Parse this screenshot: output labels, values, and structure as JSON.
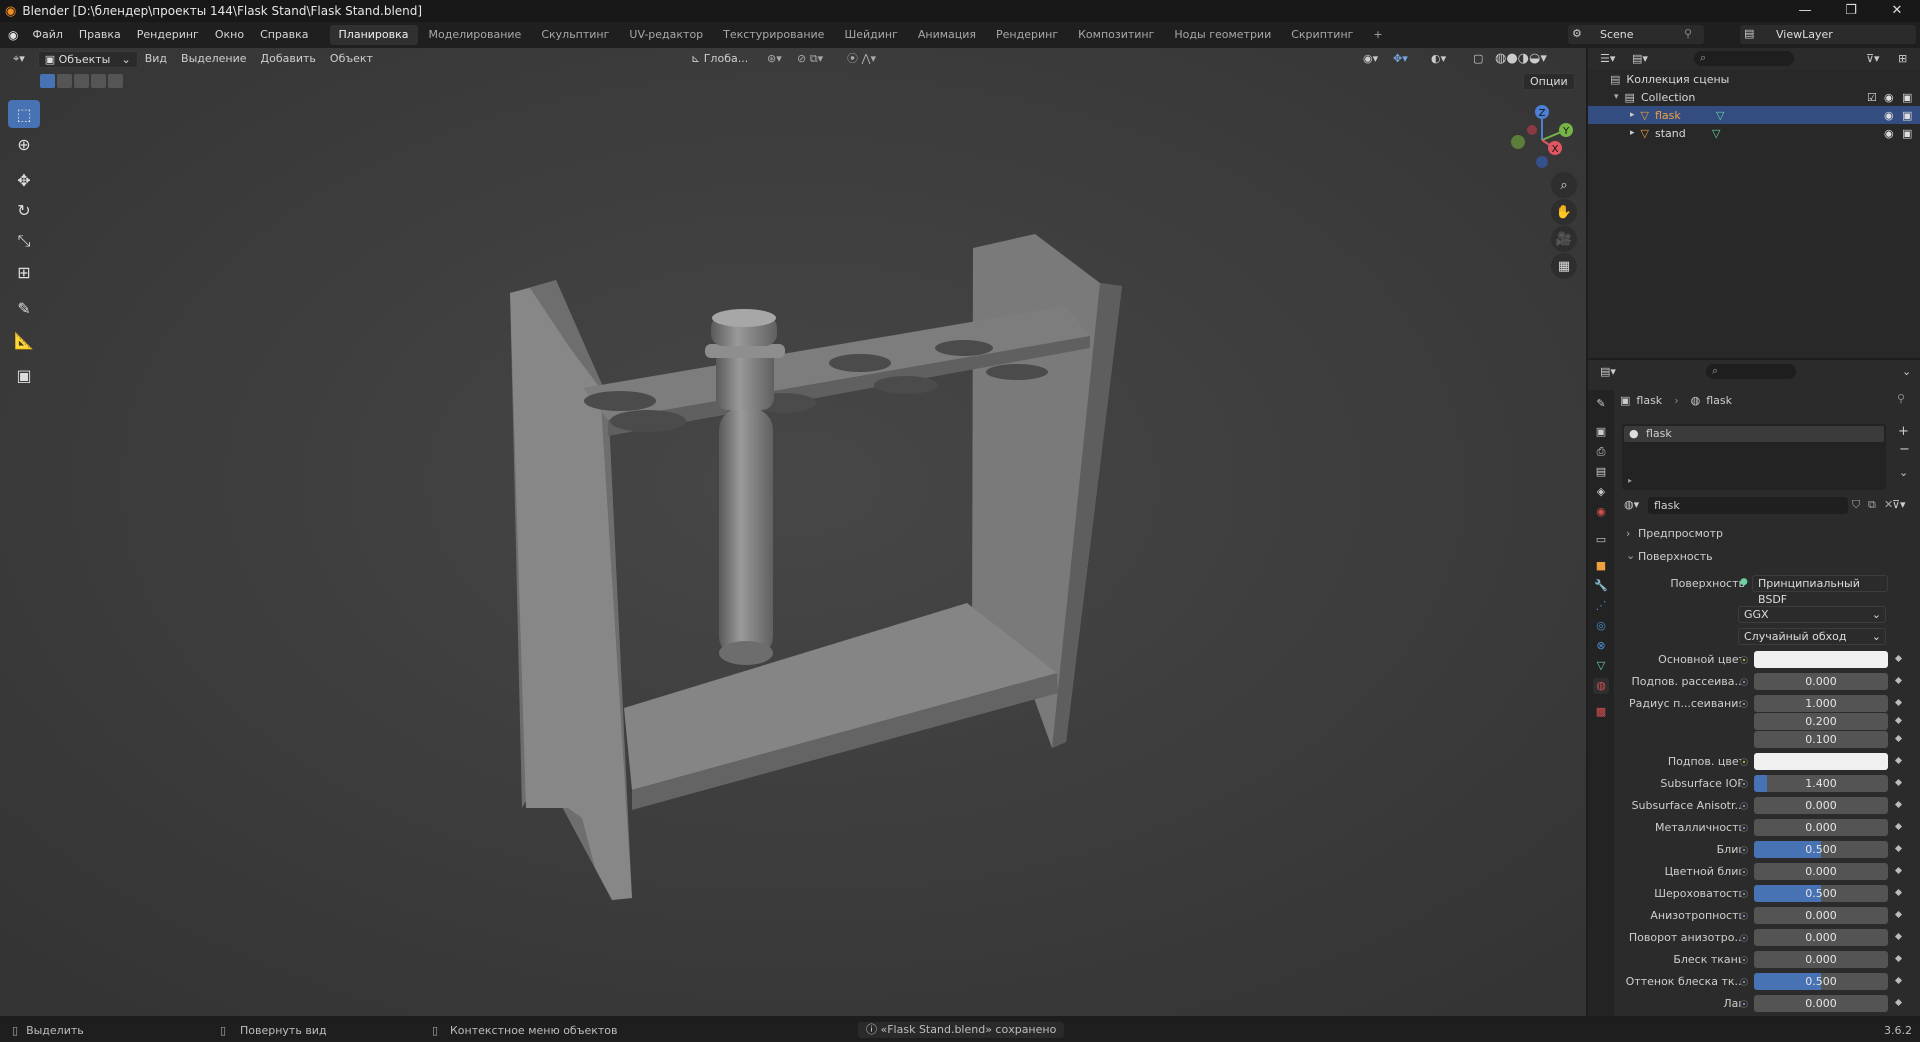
{
  "titlebar": {
    "title": "Blender [D:\\блендер\\проекты 144\\Flask Stand\\Flask Stand.blend]",
    "min": "—",
    "max": "❐",
    "close": "✕"
  },
  "menu": [
    "Файл",
    "Правка",
    "Рендеринг",
    "Окно",
    "Справка"
  ],
  "workspaces": [
    "Планировка",
    "Моделирование",
    "Скульптинг",
    "UV-редактор",
    "Текстурирование",
    "Шейдинг",
    "Анимация",
    "Рендеринг",
    "Композитинг",
    "Ноды геометрии",
    "Скриптинг",
    "+"
  ],
  "active_workspace": 0,
  "scene": {
    "label": "Scene",
    "view_layer": "ViewLayer"
  },
  "viewport_header": {
    "mode": "Объекты",
    "menus": [
      "Вид",
      "Выделение",
      "Добавить",
      "Объект"
    ],
    "orientation": "Глоба...",
    "options": "Опции"
  },
  "gizmo": {
    "z": "Z",
    "y": "Y",
    "x": "X"
  },
  "outliner": {
    "root": "Коллекция сцены",
    "collection": "Collection",
    "items": [
      "flask",
      "stand"
    ]
  },
  "properties": {
    "breadcrumb_object": "flask",
    "breadcrumb_material": "flask",
    "slot": "flask",
    "material_name": "flask",
    "sections": {
      "preview": "Предпросмотр",
      "surface": "Поверхность"
    },
    "surface_label": "Поверхность",
    "surface_value": "Принципиальный BSDF",
    "distribution": "GGX",
    "subsurface_method": "Случайный обход",
    "rows": [
      {
        "label": "Основной цвет",
        "value": "",
        "type": "color",
        "dot": "y"
      },
      {
        "label": "Подпов. рассеива...",
        "value": "0.000",
        "fill": 0
      },
      {
        "label": "Радиус п...сеивания",
        "value": "1.000",
        "fill": 0
      },
      {
        "label": "",
        "value": "0.200",
        "fill": 0,
        "nodot": true
      },
      {
        "label": "",
        "value": "0.100",
        "fill": 0,
        "nodot": true
      },
      {
        "label": "Подпов. цвет",
        "value": "",
        "type": "color",
        "dot": "y"
      },
      {
        "label": "Subsurface IOR",
        "value": "1.400",
        "fill": 0.1
      },
      {
        "label": "Subsurface Anisotr...",
        "value": "0.000",
        "fill": 0
      },
      {
        "label": "Металличность",
        "value": "0.000",
        "fill": 0
      },
      {
        "label": "Блик",
        "value": "0.500",
        "fill": 0.5
      },
      {
        "label": "Цветной блик",
        "value": "0.000",
        "fill": 0
      },
      {
        "label": "Шероховатость",
        "value": "0.500",
        "fill": 0.5
      },
      {
        "label": "Анизотропность",
        "value": "0.000",
        "fill": 0
      },
      {
        "label": "Поворот анизотро...",
        "value": "0.000",
        "fill": 0
      },
      {
        "label": "Блеск ткани",
        "value": "0.000",
        "fill": 0
      },
      {
        "label": "Оттенок блеска тк...",
        "value": "0.500",
        "fill": 0.5
      },
      {
        "label": "Лак",
        "value": "0.000",
        "fill": 0
      }
    ]
  },
  "statusbar": {
    "select": "Выделить",
    "rotate": "Повернуть вид",
    "context": "Контекстное меню объектов",
    "message": "«Flask Stand.blend» сохранено",
    "version": "3.6.2"
  },
  "colors": {
    "accent": "#4772b3",
    "selected_row": "#334d80",
    "viewport": "#3d3d3d"
  }
}
